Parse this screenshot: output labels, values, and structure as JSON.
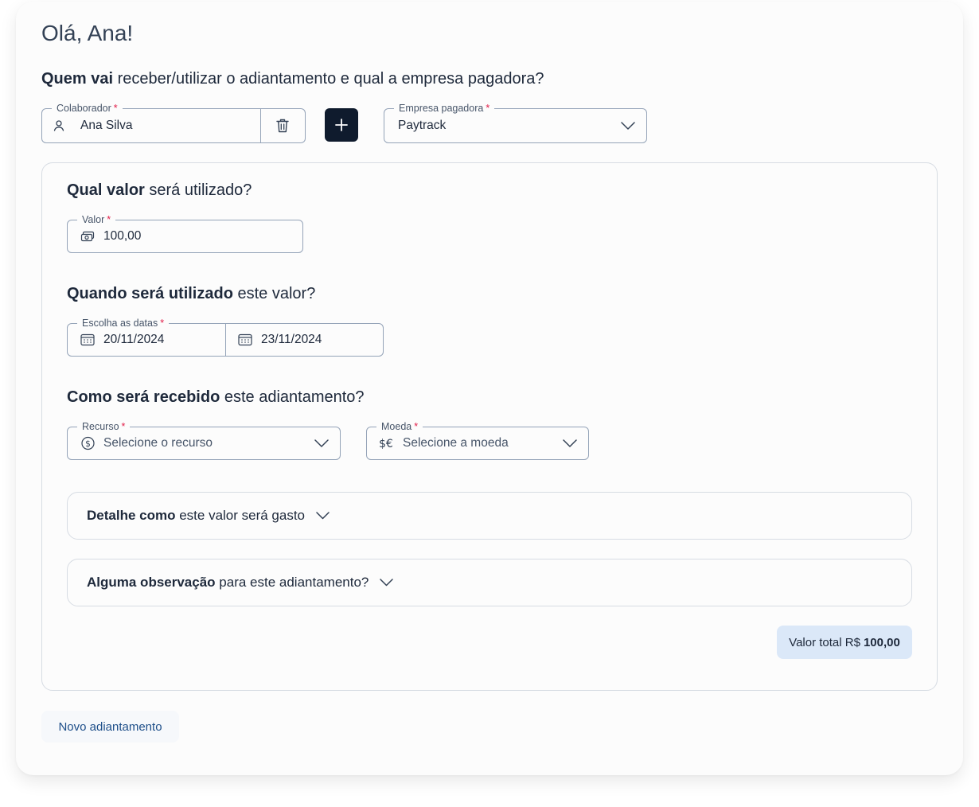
{
  "greeting": "Olá, Ana!",
  "sections": {
    "who": {
      "bold": "Quem vai",
      "rest": " receber/utilizar o adiantamento e qual a empresa pagadora?"
    },
    "value": {
      "bold": "Qual valor",
      "rest": " será utilizado?"
    },
    "when": {
      "bold": "Quando será utilizado",
      "rest": " este valor?"
    },
    "how": {
      "bold": "Como será recebido",
      "rest": " este adiantamento?"
    }
  },
  "collaborator": {
    "label": "Colaborador",
    "required_mark": "*",
    "value": "Ana Silva"
  },
  "company": {
    "label": "Empresa pagadora",
    "required_mark": "*",
    "value": "Paytrack"
  },
  "amount": {
    "label": "Valor",
    "required_mark": "*",
    "value": "100,00"
  },
  "dates": {
    "label": "Escolha as datas",
    "required_mark": "*",
    "start": "20/11/2024",
    "end": "23/11/2024"
  },
  "resource": {
    "label": "Recurso",
    "required_mark": "*",
    "placeholder": "Selecione o recurso"
  },
  "currency": {
    "label": "Moeda",
    "required_mark": "*",
    "placeholder": "Selecione a moeda"
  },
  "accordions": {
    "details": {
      "bold": "Detalhe como",
      "rest": " este valor será gasto"
    },
    "notes": {
      "bold": "Alguma observação",
      "rest": " para este adiantamento?"
    }
  },
  "total": {
    "label": "Valor total R$",
    "value": "100,00"
  },
  "new_advance_button": "Novo adiantamento",
  "colors": {
    "primary_dark": "#0f1b2d",
    "required": "#e11d48",
    "total_badge_bg": "#dbe8f8",
    "link_blue": "#1d4e89"
  },
  "icons": {
    "collaborator": "user-icon",
    "delete": "trash-icon",
    "add": "plus-icon",
    "company_dropdown": "chevron-down-icon",
    "amount": "money-icon",
    "date": "calendar-icon",
    "resource": "dollar-coin-icon",
    "currency": "currency-exchange-icon"
  }
}
